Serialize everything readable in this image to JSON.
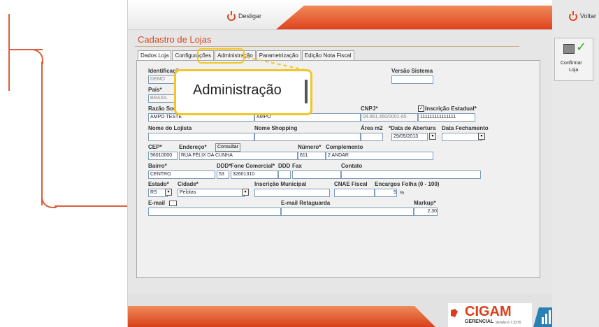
{
  "topbar": {
    "desligar": "Desligar",
    "voltar": "Voltar"
  },
  "screen_title": "Cadastro de Lojas",
  "tabs": [
    "Dados Loja",
    "Configurações",
    "Administração",
    "Parametrização",
    "Edição Nota Fiscal"
  ],
  "magnifier_text": "Administração",
  "confirm": {
    "line1": "Confirmar",
    "line2": "Loja"
  },
  "form": {
    "identificacao_label": "Identificação",
    "identificacao_value": "DEMO",
    "versao_label": "Versão Sistema",
    "pais_label": "País*",
    "pais_value": "BRASIL",
    "razao_label": "Razão Social*",
    "razao_value": "AMPO TESTE",
    "fantasia_value": "AMPO",
    "cnpj_label": "CNPJ*",
    "cnpj_value": "04.861.460/0001-65",
    "ie_label": "Inscrição Estadual*",
    "ie_value": "111111111111111",
    "lojista_label": "Nome do Lojista",
    "shopping_label": "Nome Shopping",
    "area_label": "Área m2",
    "abertura_label": "*Data de Abertura",
    "abertura_value": "29/05/2013",
    "fechamento_label": "Data Fechamento",
    "cep_label": "CEP*",
    "cep_value": "96010000",
    "endereco_label": "Endereço*",
    "consultar": "Consultar",
    "endereco_value": "RUA FÉLIX DA CUNHA",
    "numero_label": "Número*",
    "numero_value": "811",
    "complemento_label": "Complemento",
    "complemento_value": "2 ANDAR",
    "bairro_label": "Bairro*",
    "bairro_value": "CENTRO",
    "ddd_label": "DDD*",
    "ddd_value": "53",
    "fone_label": "Fone Comercial*",
    "fone_value": "32601310",
    "ddd2_label": "DDD",
    "fax_label": "Fax",
    "contato_label": "Contato",
    "estado_label": "Estado*",
    "estado_value": "RS",
    "cidade_label": "Cidade*",
    "cidade_value": "Pelotas",
    "inscmun_label": "Inscrição Municipal",
    "cnae_label": "CNAE Fiscal",
    "encargos_label": "Encargos Folha (0 - 100)",
    "encargos_value": "5",
    "percent": "%",
    "email_label": "E-mail",
    "email_ret_label": "E-mail Retaguarda",
    "markup_label": "Markup*",
    "markup_value": "2,30"
  },
  "logo": {
    "brand": "CIGAM",
    "sub": "GERENCIAL",
    "version": "Versão 6.7.3270"
  },
  "colors": {
    "accent": "#e2471d",
    "highlight": "#f0c62a"
  }
}
